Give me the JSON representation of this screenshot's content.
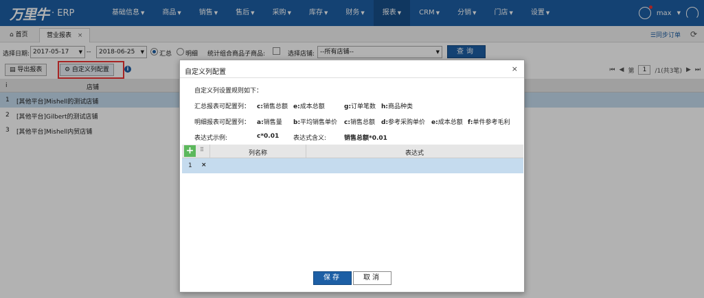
{
  "app": {
    "brand": "万里牛",
    "product": "· ERP"
  },
  "nav": [
    {
      "label": "基础信息"
    },
    {
      "label": "商品"
    },
    {
      "label": "销售"
    },
    {
      "label": "售后"
    },
    {
      "label": "采购"
    },
    {
      "label": "库存"
    },
    {
      "label": "财务"
    },
    {
      "label": "报表"
    },
    {
      "label": "CRM"
    },
    {
      "label": "分销"
    },
    {
      "label": "门店"
    },
    {
      "label": "设置"
    }
  ],
  "user": {
    "name": "max"
  },
  "tabs": {
    "home": "首页",
    "report": "营业报表",
    "close": "×"
  },
  "header_actions": {
    "sync": "☰同步订单",
    "refresh": "⟳"
  },
  "filters": {
    "date_label": "选择日期:",
    "start_date": "2017-05-17",
    "separator": "--",
    "end_date": "2018-06-25",
    "summary": "汇总",
    "detail": "明细",
    "combo_label": "统计组合商品子商品:",
    "shop_label": "选择店铺:",
    "shop_value": "--所有店铺--",
    "query": "查询"
  },
  "toolbar": {
    "export": "导出报表",
    "custom": "⚙ 自定义列配置"
  },
  "pager": {
    "page": "1",
    "text_prefix": "第",
    "text_suffix": "/1(共3笔)"
  },
  "grid": {
    "col_index": "i",
    "col_shop": "店铺",
    "rows": [
      {
        "n": "1",
        "shop": "[其他平台]Mishell的测试店铺"
      },
      {
        "n": "2",
        "shop": "[其他平台]Gilbert的测试店铺"
      },
      {
        "n": "3",
        "shop": "[其他平台]Mishell内贸店铺"
      }
    ]
  },
  "modal": {
    "title": "自定义列配置",
    "intro": "自定义列设置规则如下：",
    "summary_label": "汇总报表可配置列：",
    "summary_cols": [
      {
        "k": "c:",
        "v": "销售总额"
      },
      {
        "k": "e:",
        "v": "成本总额"
      },
      {
        "k": "g:",
        "v": "订单笔数"
      },
      {
        "k": "h:",
        "v": "商品种类"
      }
    ],
    "detail_label": "明细报表可配置列：",
    "detail_cols": [
      {
        "k": "a:",
        "v": "销售量"
      },
      {
        "k": "b:",
        "v": "平均销售单价"
      },
      {
        "k": "c:",
        "v": "销售总额"
      },
      {
        "k": "d:",
        "v": "参考采购单价"
      },
      {
        "k": "e:",
        "v": "成本总额"
      },
      {
        "k": "f:",
        "v": "单件参考毛利"
      }
    ],
    "example_label": "表达式示例:",
    "example_value": "c*0.01",
    "meaning_label": "表达式含义:",
    "meaning_value": "销售总额*0.01",
    "col_name": "列名称",
    "col_expr": "表达式",
    "row_num": "1",
    "delete": "×",
    "save": "保存",
    "cancel": "取消"
  }
}
